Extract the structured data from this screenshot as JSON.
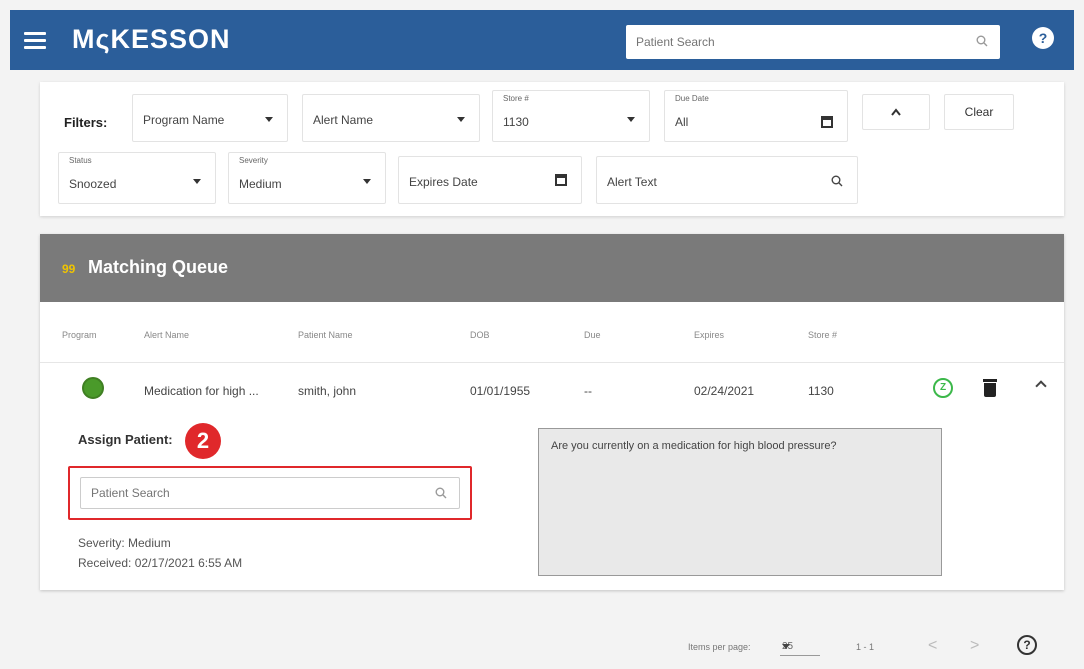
{
  "header": {
    "brand": "MςKESSON",
    "search_placeholder": "Patient Search",
    "help_icon": "?"
  },
  "filters": {
    "label": "Filters:",
    "program_name": "Program Name",
    "alert_name": "Alert Name",
    "store_label": "Store #",
    "store_value": "1130",
    "due_date_label": "Due Date",
    "due_date_value": "All",
    "clear_label": "Clear",
    "status_label": "Status",
    "status_value": "Snoozed",
    "severity_label": "Severity",
    "severity_value": "Medium",
    "expires_date": "Expires Date",
    "alert_text": "Alert Text"
  },
  "queue": {
    "icon": "99",
    "title": "Matching Queue",
    "columns": [
      "Program",
      "Alert Name",
      "Patient Name",
      "DOB",
      "Due",
      "Expires",
      "Store #"
    ],
    "row": {
      "alert_name": "Medication for high ...",
      "patient_name": "smith, john",
      "dob": "01/01/1955",
      "due": "--",
      "expires": "02/24/2021",
      "store": "1130",
      "snooze_icon": "Z"
    },
    "detail": {
      "assign_label": "Assign Patient:",
      "step_badge": "2",
      "patient_search_placeholder": "Patient Search",
      "severity": "Severity: Medium",
      "received": "Received: 02/17/2021 6:55 AM",
      "alert_text": "Are you currently on a medication for high blood pressure?"
    }
  },
  "pagination": {
    "items_per_page_label": "Items per page:",
    "items_per_page_value": "25",
    "range": "1 - 1",
    "prev": "<",
    "next": ">",
    "help": "?"
  },
  "colors": {
    "header_bg": "#2b5e9a",
    "queue_header_bg": "#7a7a7a",
    "highlight_red": "#e0282b",
    "snooze_green": "#3cb84a",
    "program_green": "#4a9a2a",
    "alert_box_bg": "#e9e9e9"
  }
}
